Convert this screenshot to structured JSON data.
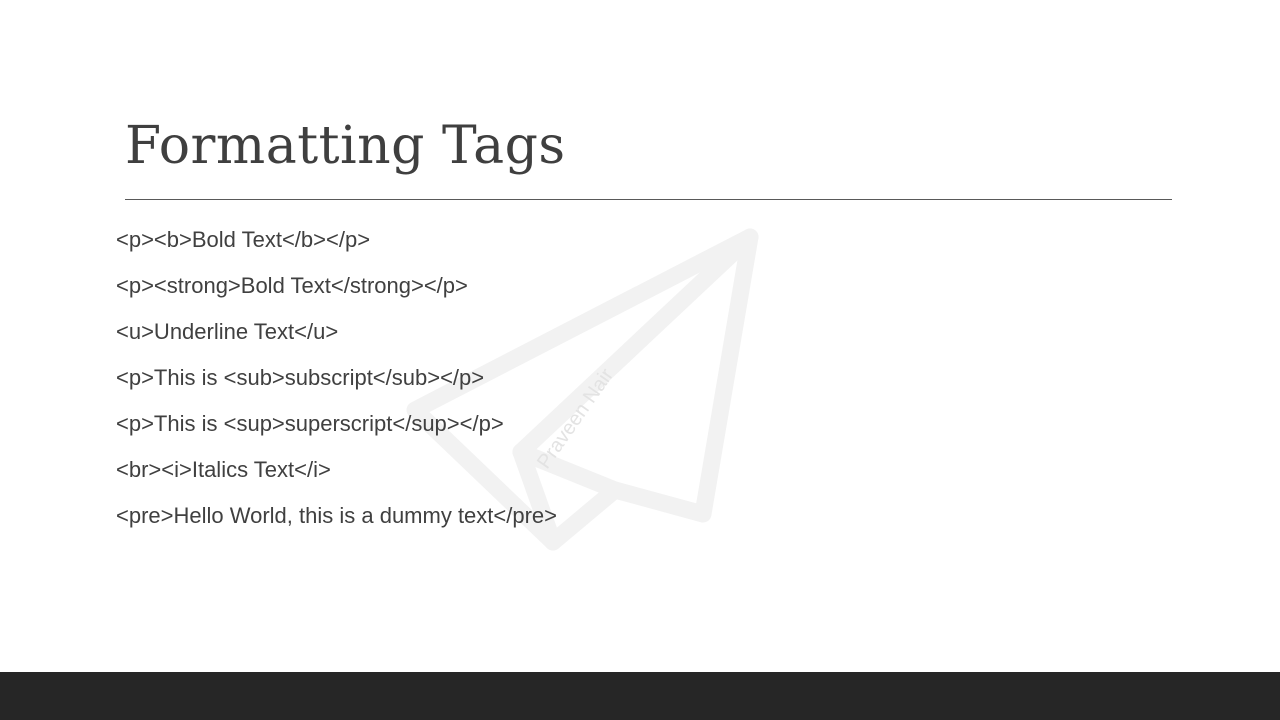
{
  "slide": {
    "title": "Formatting Tags",
    "lines": [
      "<p><b>Bold Text</b></p>",
      "<p><strong>Bold Text</strong></p>",
      "<u>Underline Text</u>",
      "<p>This is <sub>subscript</sub></p>",
      "<p>This is <sup>superscript</sup></p>",
      "<br><i>Italics Text</i>",
      "<pre>Hello World, this is a dummy text</pre>"
    ]
  },
  "watermark": {
    "icon": "paper-plane-icon",
    "text": "Praveen Nair",
    "color": "#f2f2f2",
    "text_color": "#e3e3e3"
  },
  "colors": {
    "title": "#3f3f3f",
    "body_text": "#404040",
    "rule": "#595959",
    "footer": "#262626",
    "background": "#ffffff"
  }
}
